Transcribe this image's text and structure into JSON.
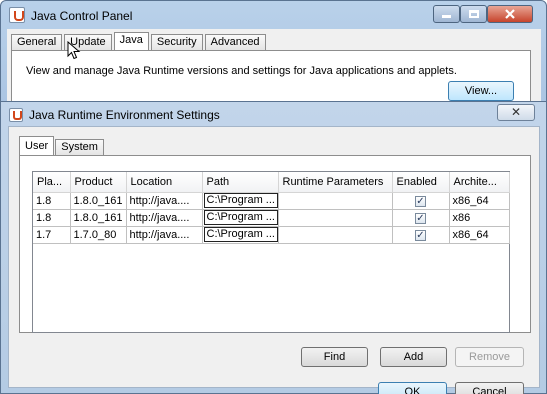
{
  "control_panel": {
    "title": "Java Control Panel",
    "tabs": [
      "General",
      "Update",
      "Java",
      "Security",
      "Advanced"
    ],
    "active_tab": "Java",
    "description": "View and manage Java Runtime versions and settings for Java applications and applets.",
    "view_button": "View..."
  },
  "dialog": {
    "title": "Java Runtime Environment Settings",
    "close_glyph": "✕",
    "tabs": [
      "User",
      "System"
    ],
    "active_tab": "User",
    "table": {
      "columns": [
        "Pla...",
        "Product",
        "Location",
        "Path",
        "Runtime Parameters",
        "Enabled",
        "Archite..."
      ],
      "rows": [
        {
          "platform": "1.8",
          "product": "1.8.0_161",
          "location": "http://java....",
          "path": "C:\\Program ...",
          "params": "",
          "enabled": true,
          "arch": "x86_64"
        },
        {
          "platform": "1.8",
          "product": "1.8.0_161",
          "location": "http://java....",
          "path": "C:\\Program ...",
          "params": "",
          "enabled": true,
          "arch": "x86"
        },
        {
          "platform": "1.7",
          "product": "1.7.0_80",
          "location": "http://java....",
          "path": "C:\\Program ...",
          "params": "",
          "enabled": true,
          "arch": "x86_64"
        }
      ]
    },
    "buttons": {
      "find": "Find",
      "add": "Add",
      "remove": "Remove",
      "ok": "OK",
      "cancel": "Cancel"
    }
  },
  "check_glyph": "✓"
}
